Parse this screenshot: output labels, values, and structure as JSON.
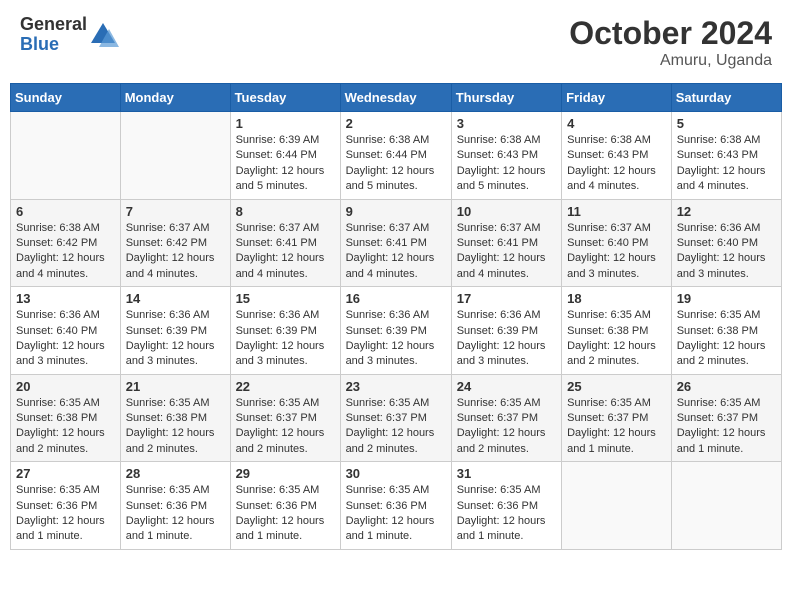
{
  "header": {
    "logo_general": "General",
    "logo_blue": "Blue",
    "month_title": "October 2024",
    "location": "Amuru, Uganda"
  },
  "weekdays": [
    "Sunday",
    "Monday",
    "Tuesday",
    "Wednesday",
    "Thursday",
    "Friday",
    "Saturday"
  ],
  "weeks": [
    [
      {
        "day": "",
        "info": ""
      },
      {
        "day": "",
        "info": ""
      },
      {
        "day": "1",
        "info": "Sunrise: 6:39 AM\nSunset: 6:44 PM\nDaylight: 12 hours\nand 5 minutes."
      },
      {
        "day": "2",
        "info": "Sunrise: 6:38 AM\nSunset: 6:44 PM\nDaylight: 12 hours\nand 5 minutes."
      },
      {
        "day": "3",
        "info": "Sunrise: 6:38 AM\nSunset: 6:43 PM\nDaylight: 12 hours\nand 5 minutes."
      },
      {
        "day": "4",
        "info": "Sunrise: 6:38 AM\nSunset: 6:43 PM\nDaylight: 12 hours\nand 4 minutes."
      },
      {
        "day": "5",
        "info": "Sunrise: 6:38 AM\nSunset: 6:43 PM\nDaylight: 12 hours\nand 4 minutes."
      }
    ],
    [
      {
        "day": "6",
        "info": "Sunrise: 6:38 AM\nSunset: 6:42 PM\nDaylight: 12 hours\nand 4 minutes."
      },
      {
        "day": "7",
        "info": "Sunrise: 6:37 AM\nSunset: 6:42 PM\nDaylight: 12 hours\nand 4 minutes."
      },
      {
        "day": "8",
        "info": "Sunrise: 6:37 AM\nSunset: 6:41 PM\nDaylight: 12 hours\nand 4 minutes."
      },
      {
        "day": "9",
        "info": "Sunrise: 6:37 AM\nSunset: 6:41 PM\nDaylight: 12 hours\nand 4 minutes."
      },
      {
        "day": "10",
        "info": "Sunrise: 6:37 AM\nSunset: 6:41 PM\nDaylight: 12 hours\nand 4 minutes."
      },
      {
        "day": "11",
        "info": "Sunrise: 6:37 AM\nSunset: 6:40 PM\nDaylight: 12 hours\nand 3 minutes."
      },
      {
        "day": "12",
        "info": "Sunrise: 6:36 AM\nSunset: 6:40 PM\nDaylight: 12 hours\nand 3 minutes."
      }
    ],
    [
      {
        "day": "13",
        "info": "Sunrise: 6:36 AM\nSunset: 6:40 PM\nDaylight: 12 hours\nand 3 minutes."
      },
      {
        "day": "14",
        "info": "Sunrise: 6:36 AM\nSunset: 6:39 PM\nDaylight: 12 hours\nand 3 minutes."
      },
      {
        "day": "15",
        "info": "Sunrise: 6:36 AM\nSunset: 6:39 PM\nDaylight: 12 hours\nand 3 minutes."
      },
      {
        "day": "16",
        "info": "Sunrise: 6:36 AM\nSunset: 6:39 PM\nDaylight: 12 hours\nand 3 minutes."
      },
      {
        "day": "17",
        "info": "Sunrise: 6:36 AM\nSunset: 6:39 PM\nDaylight: 12 hours\nand 3 minutes."
      },
      {
        "day": "18",
        "info": "Sunrise: 6:35 AM\nSunset: 6:38 PM\nDaylight: 12 hours\nand 2 minutes."
      },
      {
        "day": "19",
        "info": "Sunrise: 6:35 AM\nSunset: 6:38 PM\nDaylight: 12 hours\nand 2 minutes."
      }
    ],
    [
      {
        "day": "20",
        "info": "Sunrise: 6:35 AM\nSunset: 6:38 PM\nDaylight: 12 hours\nand 2 minutes."
      },
      {
        "day": "21",
        "info": "Sunrise: 6:35 AM\nSunset: 6:38 PM\nDaylight: 12 hours\nand 2 minutes."
      },
      {
        "day": "22",
        "info": "Sunrise: 6:35 AM\nSunset: 6:37 PM\nDaylight: 12 hours\nand 2 minutes."
      },
      {
        "day": "23",
        "info": "Sunrise: 6:35 AM\nSunset: 6:37 PM\nDaylight: 12 hours\nand 2 minutes."
      },
      {
        "day": "24",
        "info": "Sunrise: 6:35 AM\nSunset: 6:37 PM\nDaylight: 12 hours\nand 2 minutes."
      },
      {
        "day": "25",
        "info": "Sunrise: 6:35 AM\nSunset: 6:37 PM\nDaylight: 12 hours\nand 1 minute."
      },
      {
        "day": "26",
        "info": "Sunrise: 6:35 AM\nSunset: 6:37 PM\nDaylight: 12 hours\nand 1 minute."
      }
    ],
    [
      {
        "day": "27",
        "info": "Sunrise: 6:35 AM\nSunset: 6:36 PM\nDaylight: 12 hours\nand 1 minute."
      },
      {
        "day": "28",
        "info": "Sunrise: 6:35 AM\nSunset: 6:36 PM\nDaylight: 12 hours\nand 1 minute."
      },
      {
        "day": "29",
        "info": "Sunrise: 6:35 AM\nSunset: 6:36 PM\nDaylight: 12 hours\nand 1 minute."
      },
      {
        "day": "30",
        "info": "Sunrise: 6:35 AM\nSunset: 6:36 PM\nDaylight: 12 hours\nand 1 minute."
      },
      {
        "day": "31",
        "info": "Sunrise: 6:35 AM\nSunset: 6:36 PM\nDaylight: 12 hours\nand 1 minute."
      },
      {
        "day": "",
        "info": ""
      },
      {
        "day": "",
        "info": ""
      }
    ]
  ]
}
